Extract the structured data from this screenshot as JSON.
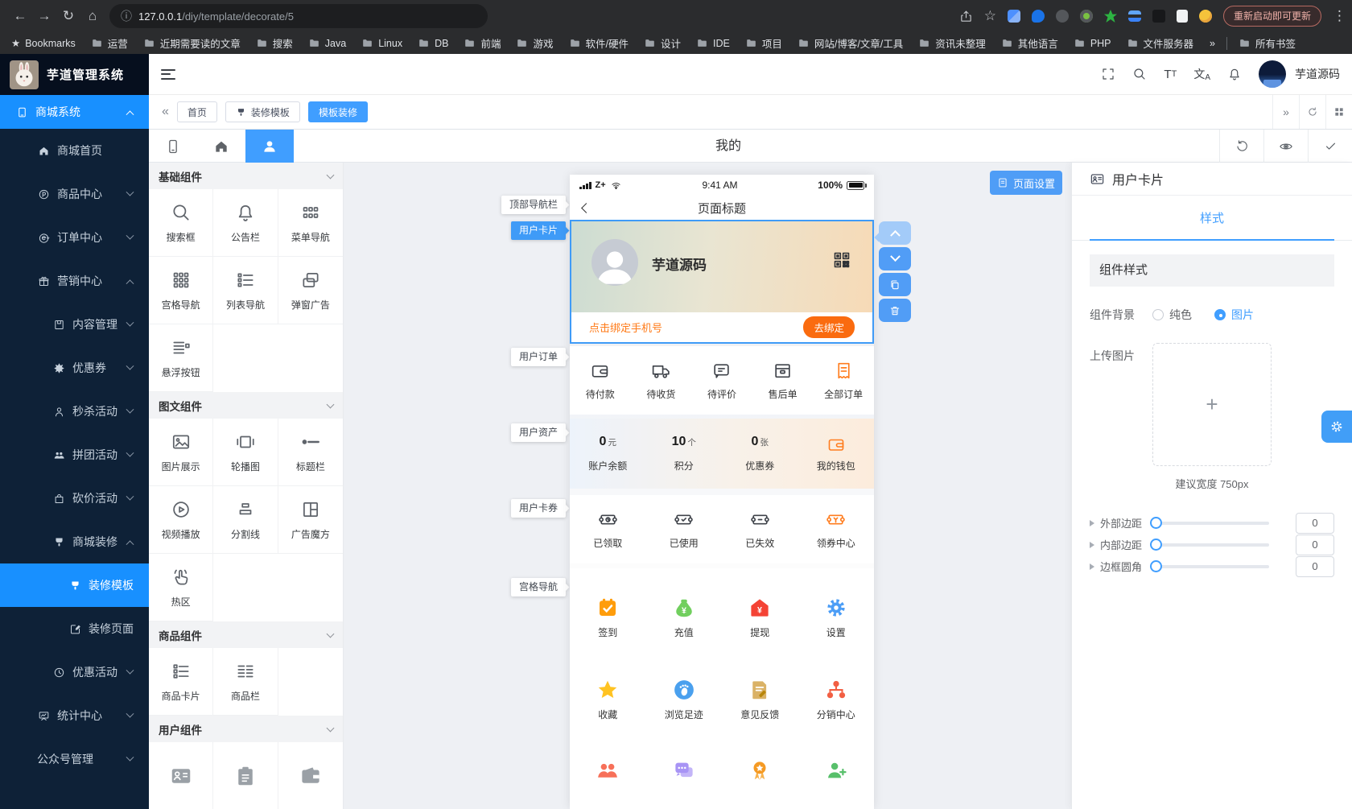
{
  "browser": {
    "url_host": "127.0.0.1",
    "url_path": "/diy/template/decorate/5",
    "update_button": "重新启动即可更新",
    "bookmarks_label": "Bookmarks",
    "bookmarks": [
      "运营",
      "近期需要读的文章",
      "搜索",
      "Java",
      "Linux",
      "DB",
      "前端",
      "游戏",
      "软件/硬件",
      "设计",
      "IDE",
      "项目",
      "网站/博客/文章/工具",
      "资讯未整理",
      "其他语言",
      "PHP",
      "文件服务器"
    ],
    "overflow_chevron": "»",
    "all_bookmarks": "所有书签"
  },
  "header": {
    "app_title": "芋道管理系统",
    "username": "芋道源码"
  },
  "nav_tabs": {
    "collapse": "«",
    "expand": "»",
    "items": [
      "首页",
      "装修模板",
      "模板装修"
    ]
  },
  "toolbar": {
    "page_title": "我的"
  },
  "sidebar": {
    "items": [
      {
        "label": "商城系统",
        "chevron": "up",
        "active": true
      },
      {
        "label": "商城首页",
        "chevron": ""
      },
      {
        "label": "商品中心",
        "chevron": "down"
      },
      {
        "label": "订单中心",
        "chevron": "down"
      },
      {
        "label": "营销中心",
        "chevron": "up"
      },
      {
        "label": "内容管理",
        "chevron": "down"
      },
      {
        "label": "优惠券",
        "chevron": "down"
      },
      {
        "label": "秒杀活动",
        "chevron": "down"
      },
      {
        "label": "拼团活动",
        "chevron": "down"
      },
      {
        "label": "砍价活动",
        "chevron": "down"
      },
      {
        "label": "商城装修",
        "chevron": "up"
      },
      {
        "label": "装修模板",
        "chevron": "",
        "active": true
      },
      {
        "label": "装修页面",
        "chevron": ""
      },
      {
        "label": "优惠活动",
        "chevron": "down"
      },
      {
        "label": "统计中心",
        "chevron": "down"
      },
      {
        "label": "公众号管理",
        "chevron": "down"
      }
    ]
  },
  "palette": {
    "sections": [
      {
        "title": "基础组件",
        "items": [
          "搜索框",
          "公告栏",
          "菜单导航",
          "宫格导航",
          "列表导航",
          "弹窗广告",
          "悬浮按钮"
        ]
      },
      {
        "title": "图文组件",
        "items": [
          "图片展示",
          "轮播图",
          "标题栏",
          "视频播放",
          "分割线",
          "广告魔方",
          "热区"
        ]
      },
      {
        "title": "商品组件",
        "items": [
          "商品卡片",
          "商品栏"
        ]
      },
      {
        "title": "用户组件",
        "items": []
      }
    ]
  },
  "canvas": {
    "page_settings": "页面设置"
  },
  "phone": {
    "status": {
      "carrier": "Z+",
      "time": "9:41 AM",
      "battery": "100%"
    },
    "nav": {
      "title": "页面标题"
    },
    "markers": [
      "顶部导航栏",
      "用户卡片",
      "用户订单",
      "用户资产",
      "用户卡券",
      "宫格导航"
    ],
    "user_card": {
      "name": "芋道源码",
      "bind_tip": "点击绑定手机号",
      "bind_button": "去绑定"
    },
    "orders": [
      "待付款",
      "待收货",
      "待评价",
      "售后单",
      "全部订单"
    ],
    "assets": [
      {
        "value": "0",
        "unit": "元",
        "label": "账户余额"
      },
      {
        "value": "10",
        "unit": "个",
        "label": "积分"
      },
      {
        "value": "0",
        "unit": "张",
        "label": "优惠券"
      },
      {
        "value": "",
        "unit": "",
        "label": "我的钱包"
      }
    ],
    "coupons": [
      "已领取",
      "已使用",
      "已失效",
      "领券中心"
    ],
    "nav_grid": [
      "签到",
      "充值",
      "提现",
      "设置",
      "收藏",
      "浏览足迹",
      "意见反馈",
      "分销中心"
    ]
  },
  "props": {
    "title": "用户卡片",
    "tab": "样式",
    "section": "组件样式",
    "bg": {
      "label": "组件背景",
      "options": [
        "纯色",
        "图片"
      ],
      "selected": "图片"
    },
    "upload": {
      "label": "上传图片",
      "hint": "建议宽度 750px"
    },
    "sliders": [
      {
        "label": "外部边距",
        "value": "0"
      },
      {
        "label": "内部边距",
        "value": "0"
      },
      {
        "label": "边框圆角",
        "value": "0"
      }
    ]
  },
  "colors": {
    "accent": "#409eff",
    "sidebar_active": "#1890ff",
    "orange": "#ff7d1f"
  }
}
